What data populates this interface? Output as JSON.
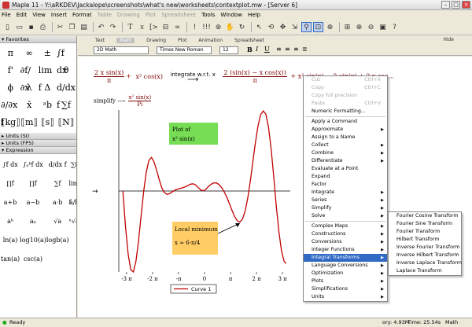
{
  "window": {
    "title": "Maple 11 - Y:\\aRKDEV\\Jackalope\\screenshots\\what's new\\worksheets\\contextplot.mw - [Server 6]"
  },
  "menubar": [
    {
      "label": "File",
      "enabled": true
    },
    {
      "label": "Edit",
      "enabled": true
    },
    {
      "label": "View",
      "enabled": true
    },
    {
      "label": "Insert",
      "enabled": true
    },
    {
      "label": "Format",
      "enabled": true
    },
    {
      "label": "Table",
      "enabled": false
    },
    {
      "label": "Drawing",
      "enabled": false
    },
    {
      "label": "Plot",
      "enabled": false
    },
    {
      "label": "Spreadsheet",
      "enabled": false
    },
    {
      "label": "Tools",
      "enabled": true
    },
    {
      "label": "Window",
      "enabled": true
    },
    {
      "label": "Help",
      "enabled": true
    }
  ],
  "palettes": {
    "favorites": {
      "title": "Favorites",
      "row1": [
        "π",
        "∞",
        "±",
        "∫f dx"
      ],
      "row2": [
        "f'",
        "∂f/∂x",
        "lim f",
        "θ"
      ],
      "row3": [
        "ϕ",
        "λ",
        "Δ",
        "d/dx f"
      ],
      "row4": [
        "∂/∂x f",
        "x̄",
        "ᵃb",
        "∑f"
      ],
      "row5": [
        "⟦kg⟧",
        "⟦m⟧",
        "⟦s⟧",
        "⟦N⟧"
      ]
    },
    "units_si": {
      "title": "Units (SI)"
    },
    "units_fps": {
      "title": "Units (FPS)"
    },
    "expression": {
      "title": "Expression",
      "row1": [
        "∫f dx",
        "∫ₐᵇf dx",
        "d/dx f",
        "∑f"
      ],
      "row2": [
        "∏f",
        "∏f",
        "∑f",
        "lim f"
      ],
      "row3": [
        "a+b",
        "a−b",
        "a·b",
        "a/b"
      ],
      "row4": [
        "aᵇ",
        "aₙ",
        "√a",
        "ⁿ√a"
      ],
      "row5": [
        "ln(a)",
        "log10(a)",
        "logb(a)",
        ""
      ],
      "row6": [
        "tan(a)",
        "csc(a)",
        "",
        ""
      ]
    }
  },
  "context": {
    "tabs": [
      "Text",
      "Math",
      "Drawing",
      "Plot",
      "Animation",
      "Spreadsheet"
    ],
    "hide": "Hide",
    "style": "2D Math",
    "font": "Times New Roman",
    "size": "12",
    "bold": "B",
    "italic": "I",
    "underline": "U"
  },
  "document": {
    "arrow_label": "integrate w.r.t. x",
    "simplify_label": "simplify",
    "expr_lhs_a": "2 x sin(x)",
    "expr_lhs_b": "π",
    "expr_lhs_c": "x² cos(x)",
    "expr_rhs_num": "2 (sin(x) − x cos(x))",
    "expr_rhs_den": "π",
    "expr_rhs2": "+ x² sin(x) = 2 sin(x) + 2 x cos...",
    "res_num": "x² sin(x)",
    "res_den": "Pi"
  },
  "chart_data": {
    "type": "line",
    "title": "",
    "xlabel": "",
    "ylabel": "",
    "x_ticks": [
      "-3 π",
      "-2 π",
      "-π",
      "0",
      "π",
      "2 π",
      "3 π"
    ],
    "xlim": [
      -3.3,
      3.3
    ],
    "ylim": [
      -19,
      19
    ],
    "series": [
      {
        "name": "Curve 1",
        "color": "#c00000",
        "x": [
          -3.14159,
          -3.04,
          -2.94,
          -2.84,
          -2.74,
          -2.64,
          -2.54,
          -2.44,
          -2.34,
          -2.24,
          -2.14,
          -2.04,
          -1.94,
          -1.84,
          -1.74,
          -1.64,
          -1.54,
          -1.44,
          -1.34,
          -1.24,
          -1.14,
          -1.04,
          -0.94,
          -0.84,
          -0.74,
          -0.64,
          -0.54,
          -0.44,
          -0.34,
          -0.24,
          -0.14,
          -0.04,
          0,
          0.06,
          0.16,
          0.26,
          0.36,
          0.46,
          0.56,
          0.66,
          0.76,
          0.86,
          0.96,
          1.06,
          1.16,
          1.26,
          1.36,
          1.46,
          1.56,
          1.66,
          1.76,
          1.86,
          1.96,
          2.06,
          2.16,
          2.26,
          2.36,
          2.46,
          2.56,
          2.66,
          2.76,
          2.86,
          2.96,
          3.06,
          3.14159
        ],
        "y": [
          0,
          -8.5,
          -14.8,
          -18.5,
          -19,
          -16.5,
          -11.7,
          -5.8,
          0,
          4.5,
          7.2,
          7.9,
          6.8,
          4.8,
          2.6,
          0.7,
          -0.4,
          -0.8,
          -0.6,
          -0.2,
          0.2,
          0.4,
          0.6,
          0.8,
          1.0,
          1.3,
          1.6,
          1.7,
          1.4,
          0.8,
          0.2,
          0.1,
          0.1,
          0.5,
          1.1,
          1.6,
          1.9,
          1.9,
          1.5,
          0.8,
          -0.2,
          -1.5,
          -3.0,
          -4.6,
          -6.0,
          -7.0,
          -7.3,
          -6.6,
          -4.8,
          -1.8,
          2.2,
          6.8,
          11.4,
          15.3,
          17.9,
          18.8,
          18.0,
          15.0,
          10.0,
          3.5,
          -3.5,
          -9.5,
          -14.0,
          -16.5,
          -17
        ]
      }
    ],
    "annotations": [
      {
        "text": "Plot of",
        "formula": "x² sin(x)",
        "bg": "#77dd55"
      },
      {
        "text": "Local minimum",
        "formula": "x ≈ 6·π/4",
        "bg": "#ffcc66"
      }
    ],
    "legend": "bottom-center"
  },
  "context_menu": [
    {
      "label": "Cut",
      "shortcut": "Ctrl+X",
      "enabled": false
    },
    {
      "label": "Copy",
      "shortcut": "Ctrl+C",
      "enabled": false
    },
    {
      "label": "Copy full precision",
      "shortcut": "",
      "enabled": false
    },
    {
      "label": "Paste",
      "shortcut": "Ctrl+V",
      "enabled": false
    },
    {
      "label": "Numeric Formatting...",
      "shortcut": "",
      "enabled": true
    },
    {
      "sep": true
    },
    {
      "label": "Apply a Command",
      "enabled": true
    },
    {
      "label": "Approximate",
      "enabled": true,
      "sub": true
    },
    {
      "label": "Assign to a Name",
      "enabled": true
    },
    {
      "label": "Collect",
      "enabled": true,
      "sub": true
    },
    {
      "label": "Combine",
      "enabled": true,
      "sub": true
    },
    {
      "label": "Differentiate",
      "enabled": true,
      "sub": true
    },
    {
      "label": "Evaluate at a Point",
      "enabled": true
    },
    {
      "label": "Expand",
      "enabled": true
    },
    {
      "label": "Factor",
      "enabled": true
    },
    {
      "label": "Integrate",
      "enabled": true,
      "sub": true
    },
    {
      "label": "Series",
      "enabled": true,
      "sub": true
    },
    {
      "label": "Simplify",
      "enabled": true,
      "sub": true
    },
    {
      "label": "Solve",
      "enabled": true,
      "sub": true
    },
    {
      "sep": true
    },
    {
      "label": "Complex Maps",
      "enabled": true,
      "sub": true
    },
    {
      "label": "Constructions",
      "enabled": true,
      "sub": true
    },
    {
      "label": "Conversions",
      "enabled": true,
      "sub": true
    },
    {
      "label": "Integer Functions",
      "enabled": true,
      "sub": true
    },
    {
      "label": "Integral Transforms",
      "enabled": true,
      "sub": true,
      "highlight": true
    },
    {
      "label": "Language Conversions",
      "enabled": true,
      "sub": true
    },
    {
      "label": "Optimization",
      "enabled": true,
      "sub": true
    },
    {
      "label": "Plots",
      "enabled": true,
      "sub": true
    },
    {
      "label": "Simplifications",
      "enabled": true,
      "sub": true
    },
    {
      "label": "Units",
      "enabled": true,
      "sub": true
    }
  ],
  "submenu": [
    "Fourier Cosine Transform",
    "Fourier Sine Transform",
    "Fourier Transform",
    "Hilbert Transform",
    "Inverse Fourier Transform",
    "Inverse Hilbert Transform",
    "Inverse Laplace Transform",
    "Laplace Transform"
  ],
  "status": {
    "left": "Ready",
    "memory": "ory: 4.93M",
    "time": "Time: 25.54s",
    "mode": "Math Mode"
  }
}
